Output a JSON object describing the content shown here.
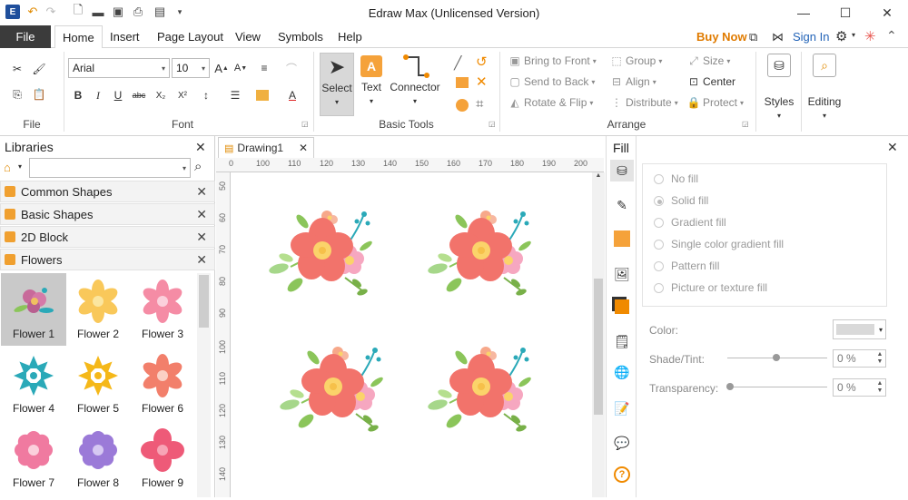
{
  "app": {
    "title": "Edraw Max (Unlicensed Version)"
  },
  "tabs": {
    "file": "File",
    "items": [
      "Home",
      "Insert",
      "Page Layout",
      "View",
      "Symbols",
      "Help"
    ],
    "active": "Home"
  },
  "account": {
    "buy_now": "Buy Now",
    "sign_in": "Sign In"
  },
  "ribbon": {
    "groups": {
      "file": "File",
      "font": "Font",
      "basic_tools": "Basic Tools",
      "arrange": "Arrange"
    },
    "font_name": "Arial",
    "font_size": "10",
    "select_label": "Select",
    "text_label": "Text",
    "connector_label": "Connector",
    "text_glyph": "A",
    "arrange": {
      "bring_to_front": "Bring to Front",
      "send_to_back": "Send to Back",
      "rotate_flip": "Rotate & Flip",
      "group": "Group",
      "align": "Align",
      "distribute": "Distribute",
      "size": "Size",
      "center": "Center",
      "protect": "Protect"
    },
    "styles_label": "Styles",
    "editing_label": "Editing",
    "font_buttons": {
      "bold": "B",
      "italic": "I",
      "underline": "U",
      "strike": "abc",
      "subscript": "X₂",
      "superscript": "X²"
    }
  },
  "libraries": {
    "title": "Libraries",
    "sections": [
      "Common Shapes",
      "Basic Shapes",
      "2D Block",
      "Flowers"
    ],
    "flowers": [
      "Flower 1",
      "Flower 2",
      "Flower 3",
      "Flower 4",
      "Flower 5",
      "Flower 6",
      "Flower 7",
      "Flower 8",
      "Flower 9"
    ],
    "selected": "Flower 1"
  },
  "document": {
    "tab_title": "Drawing1"
  },
  "rulers": {
    "h_ticks": [
      "0",
      "100",
      "110",
      "120",
      "130",
      "140",
      "150",
      "160",
      "170",
      "180",
      "190",
      "200"
    ],
    "v_ticks": [
      "50",
      "60",
      "70",
      "80",
      "90",
      "100",
      "110",
      "120",
      "130",
      "140"
    ]
  },
  "fill_panel": {
    "title": "Fill",
    "options": [
      "No fill",
      "Solid fill",
      "Gradient fill",
      "Single color gradient fill",
      "Pattern fill",
      "Picture or texture fill"
    ],
    "selected": "Solid fill",
    "color_label": "Color:",
    "shade_label": "Shade/Tint:",
    "shade_value": "0 %",
    "transparency_label": "Transparency:",
    "transparency_value": "0 %"
  },
  "colors": {
    "accent": "#2b5aa8",
    "file_tab": "#3b3b3b",
    "buy_now": "#e07b00",
    "library_star": "#f0a030",
    "flower_coral": "#f2736b",
    "flower_yellow": "#fbd36a",
    "flower_pink": "#f6a7c0",
    "leaf_green": "#8bc55a",
    "teal": "#2aa9b8"
  }
}
